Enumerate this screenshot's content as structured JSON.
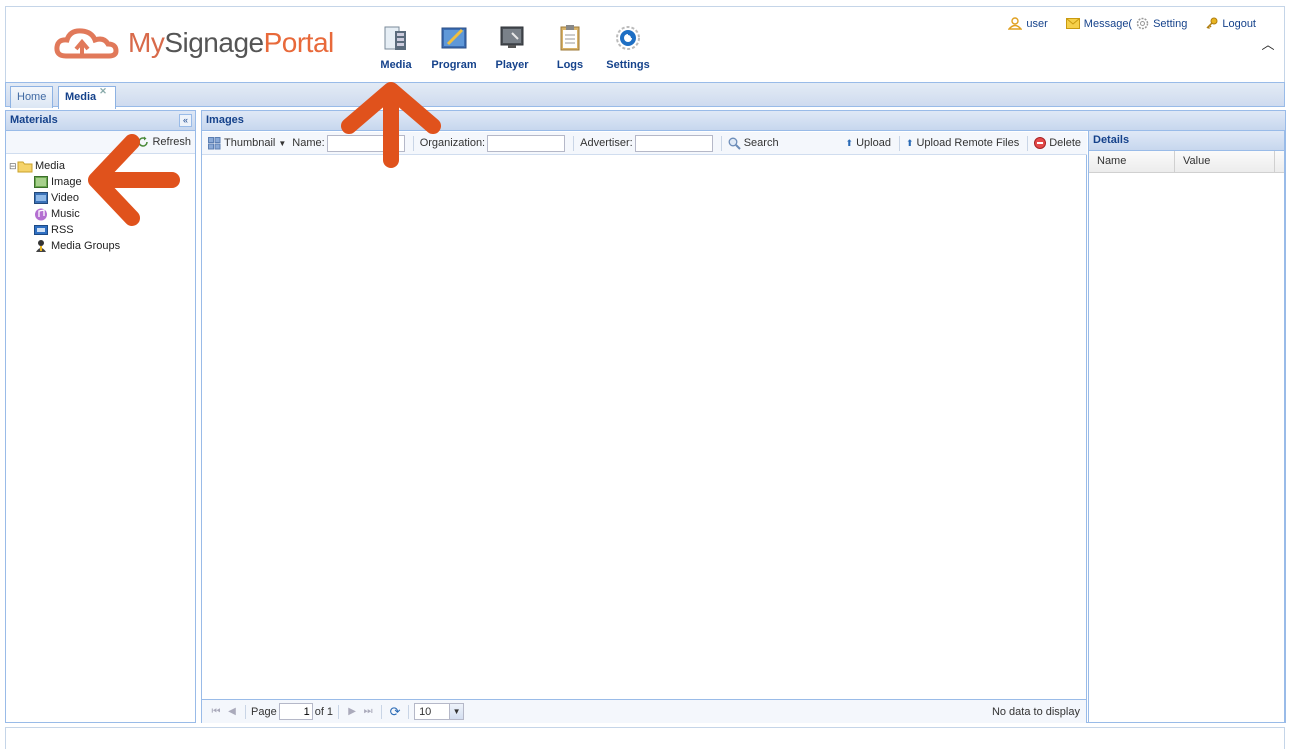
{
  "brand": {
    "logo_text_a": "My",
    "logo_text_b": "Signage",
    "logo_text_c": "Portal"
  },
  "topnav": [
    {
      "label": "Media",
      "icon": "media-icon"
    },
    {
      "label": "Program",
      "icon": "program-icon"
    },
    {
      "label": "Player",
      "icon": "player-icon"
    },
    {
      "label": "Logs",
      "icon": "logs-icon"
    },
    {
      "label": "Settings",
      "icon": "settings-icon"
    }
  ],
  "userbar": {
    "user": "user",
    "message": "Message(",
    "setting": "Setting",
    "logout": "Logout"
  },
  "tabs": {
    "home": "Home",
    "media": "Media"
  },
  "materials": {
    "title": "Materials",
    "refresh": "Refresh",
    "tree": {
      "root": "Media",
      "children": [
        "Image",
        "Video",
        "Music",
        "RSS",
        "Media Groups"
      ]
    }
  },
  "images": {
    "title": "Images",
    "toolbar": {
      "thumbnail": "Thumbnail",
      "name_label": "Name:",
      "organization_label": "Organization:",
      "advertiser_label": "Advertiser:",
      "search": "Search",
      "upload": "Upload",
      "upload_remote": "Upload Remote Files",
      "delete": "Delete"
    },
    "pager": {
      "page_label": "Page",
      "page_value": "1",
      "of_label": "of 1",
      "page_size": "10",
      "message": "No data to display"
    }
  },
  "details": {
    "title": "Details",
    "columns": [
      "Name",
      "Value"
    ]
  },
  "colors": {
    "accent": "#15428b",
    "border": "#99bbe8",
    "logo_orange": "#e8693a",
    "arrow": "#e0521c"
  }
}
